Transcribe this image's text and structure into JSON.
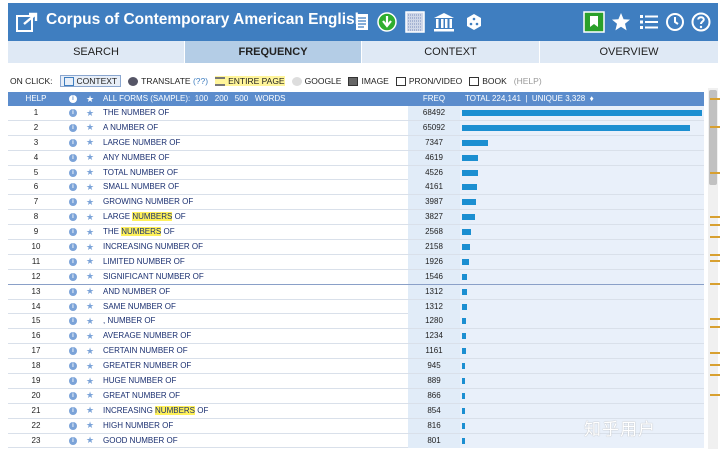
{
  "header": {
    "title": "Corpus of Contemporary American English",
    "icons": [
      "share-icon",
      "document-icon",
      "download-icon",
      "texture-icon",
      "library-icon",
      "dice-icon",
      "bookmark-icon",
      "star-icon",
      "list-icon",
      "history-icon",
      "help-icon"
    ],
    "accent": "#3f7ec0"
  },
  "tabs": [
    "SEARCH",
    "FREQUENCY",
    "CONTEXT",
    "OVERVIEW"
  ],
  "onclick": {
    "label": "ON CLICK:",
    "context": "CONTEXT",
    "translate": "TRANSLATE",
    "translate_extra": "(??)",
    "entire_page": "ENTIRE PAGE",
    "google": "GOOGLE",
    "image": "IMAGE",
    "pron": "PRON/VIDEO",
    "book": "BOOK",
    "help": "(HELP)"
  },
  "table": {
    "help": "HELP",
    "all_forms": "ALL FORMS (SAMPLE):",
    "sample_sizes": [
      "100",
      "200",
      "500"
    ],
    "words": "WORDS",
    "freq": "FREQ",
    "total": "TOTAL 224,141",
    "unique": "UNIQUE 3,328",
    "rows": [
      {
        "n": "1",
        "pre": "THE NUMBER OF",
        "hl": "",
        "post": "",
        "freq": "68492",
        "value": 68492
      },
      {
        "n": "2",
        "pre": "A NUMBER OF",
        "hl": "",
        "post": "",
        "freq": "65092",
        "value": 65092
      },
      {
        "n": "3",
        "pre": "LARGE NUMBER OF",
        "hl": "",
        "post": "",
        "freq": "7347",
        "value": 7347
      },
      {
        "n": "4",
        "pre": "ANY NUMBER OF",
        "hl": "",
        "post": "",
        "freq": "4619",
        "value": 4619
      },
      {
        "n": "5",
        "pre": "TOTAL NUMBER OF",
        "hl": "",
        "post": "",
        "freq": "4526",
        "value": 4526
      },
      {
        "n": "6",
        "pre": "SMALL NUMBER OF",
        "hl": "",
        "post": "",
        "freq": "4161",
        "value": 4161
      },
      {
        "n": "7",
        "pre": "GROWING NUMBER OF",
        "hl": "",
        "post": "",
        "freq": "3987",
        "value": 3987
      },
      {
        "n": "8",
        "pre": "LARGE ",
        "hl": "NUMBERS",
        "post": " OF",
        "freq": "3827",
        "value": 3827
      },
      {
        "n": "9",
        "pre": "THE ",
        "hl": "NUMBERS",
        "post": " OF",
        "freq": "2568",
        "value": 2568
      },
      {
        "n": "10",
        "pre": "INCREASING NUMBER OF",
        "hl": "",
        "post": "",
        "freq": "2158",
        "value": 2158
      },
      {
        "n": "11",
        "pre": "LIMITED NUMBER OF",
        "hl": "",
        "post": "",
        "freq": "1926",
        "value": 1926
      },
      {
        "n": "12",
        "pre": "SIGNIFICANT NUMBER OF",
        "hl": "",
        "post": "",
        "freq": "1546",
        "value": 1546
      },
      {
        "n": "13",
        "pre": "AND NUMBER OF",
        "hl": "",
        "post": "",
        "freq": "1312",
        "value": 1312
      },
      {
        "n": "14",
        "pre": "SAME NUMBER OF",
        "hl": "",
        "post": "",
        "freq": "1312",
        "value": 1312
      },
      {
        "n": "15",
        "pre": ", NUMBER OF",
        "hl": "",
        "post": "",
        "freq": "1280",
        "value": 1280
      },
      {
        "n": "16",
        "pre": "AVERAGE NUMBER OF",
        "hl": "",
        "post": "",
        "freq": "1234",
        "value": 1234
      },
      {
        "n": "17",
        "pre": "CERTAIN NUMBER OF",
        "hl": "",
        "post": "",
        "freq": "1161",
        "value": 1161
      },
      {
        "n": "18",
        "pre": "GREATER NUMBER OF",
        "hl": "",
        "post": "",
        "freq": "945",
        "value": 945
      },
      {
        "n": "19",
        "pre": "HUGE NUMBER OF",
        "hl": "",
        "post": "",
        "freq": "889",
        "value": 889
      },
      {
        "n": "20",
        "pre": "GREAT NUMBER OF",
        "hl": "",
        "post": "",
        "freq": "866",
        "value": 866
      },
      {
        "n": "21",
        "pre": "INCREASING ",
        "hl": "NUMBERS",
        "post": " OF",
        "freq": "854",
        "value": 854
      },
      {
        "n": "22",
        "pre": "HIGH NUMBER OF",
        "hl": "",
        "post": "",
        "freq": "816",
        "value": 816
      },
      {
        "n": "23",
        "pre": "GOOD NUMBER OF",
        "hl": "",
        "post": "",
        "freq": "801",
        "value": 801
      }
    ]
  },
  "watermark": "知乎用户"
}
